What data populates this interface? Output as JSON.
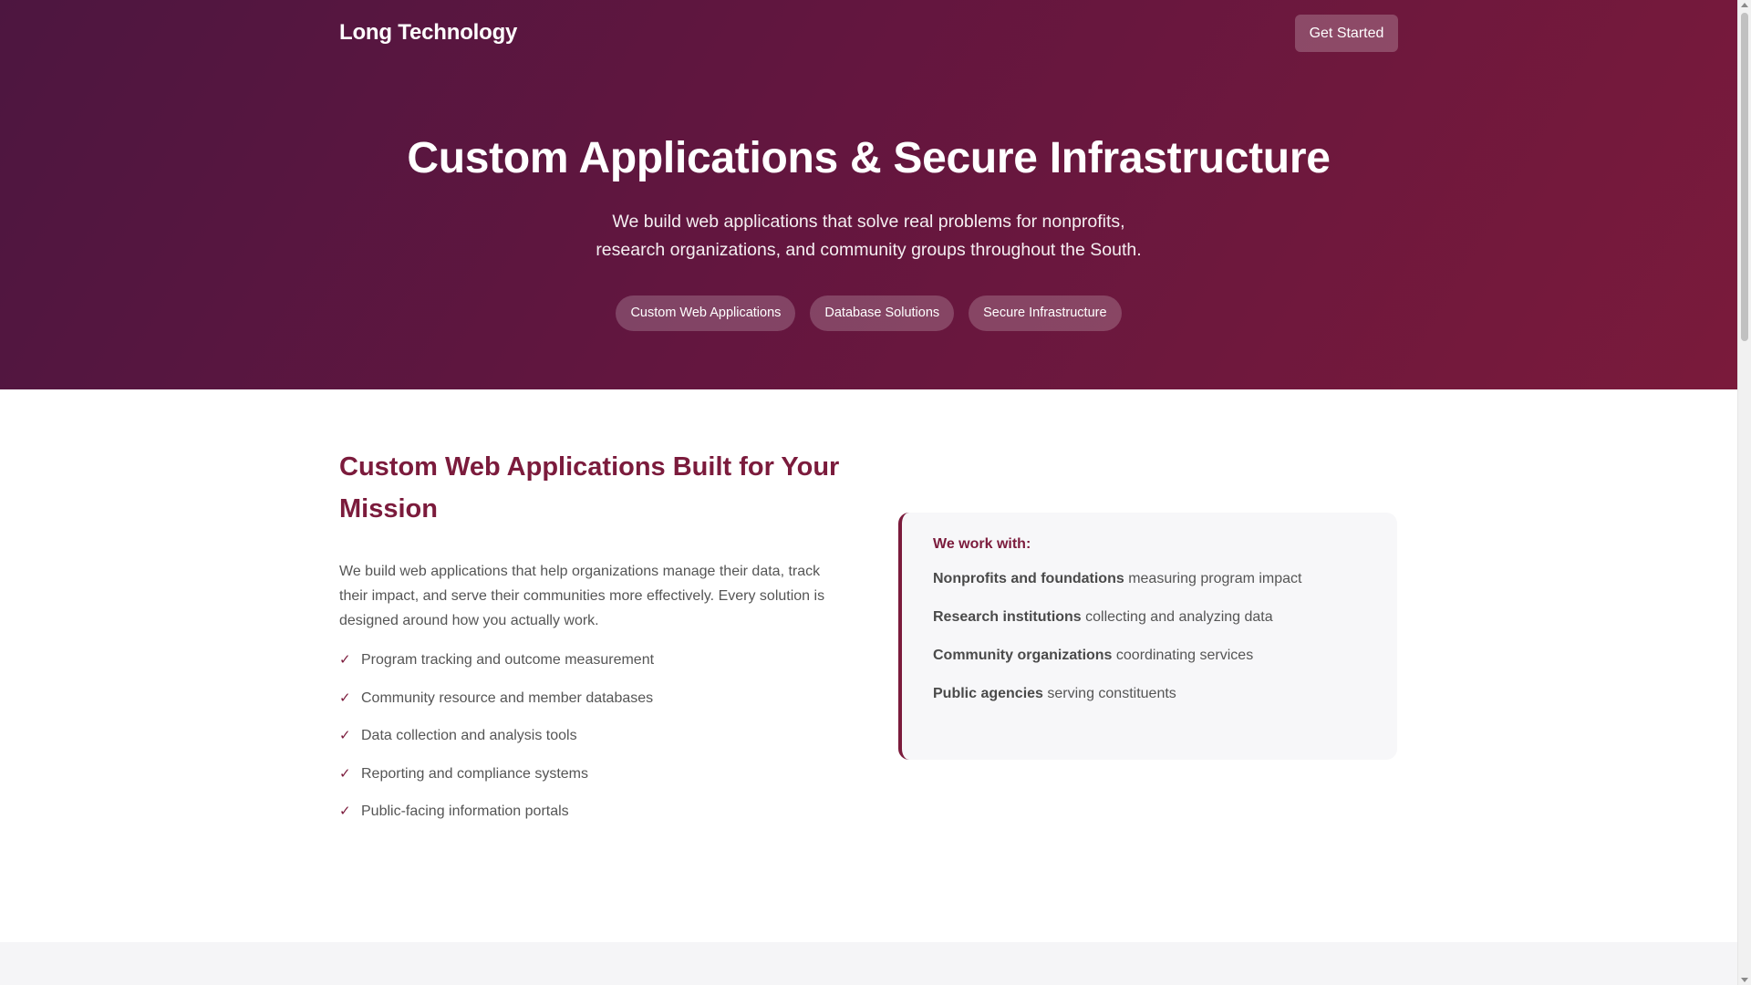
{
  "header": {
    "brand": "Long Technology",
    "cta_label": "Get Started"
  },
  "hero": {
    "title": "Custom Applications & Secure Infrastructure",
    "subtitle_line1": "We build web applications that solve real problems for nonprofits,",
    "subtitle_line2": "research organizations, and community groups throughout the South.",
    "pills": [
      "Custom Web Applications",
      "Database Solutions",
      "Secure Infrastructure"
    ]
  },
  "section": {
    "title": "Custom Web Applications Built for Your Mission",
    "body": "We build web applications that help organizations manage their data, track their impact, and serve their communities more effectively. Every solution is designed around how you actually work.",
    "check_icon": "✓",
    "features": [
      "Program tracking and outcome measurement",
      "Community resource and member databases",
      "Data collection and analysis tools",
      "Reporting and compliance systems",
      "Public-facing information portals"
    ]
  },
  "card": {
    "title": "We work with:",
    "items": [
      {
        "strong": "Nonprofits and foundations",
        "rest": " measuring program impact"
      },
      {
        "strong": "Research institutions",
        "rest": " collecting and analyzing data"
      },
      {
        "strong": "Community organizations",
        "rest": " coordinating services"
      },
      {
        "strong": "Public agencies",
        "rest": " serving constituents"
      }
    ]
  },
  "colors": {
    "accent": "#7b1b3c",
    "hero_start": "#4d1640",
    "hero_end": "#7a1a3b",
    "text_muted": "#555555"
  }
}
